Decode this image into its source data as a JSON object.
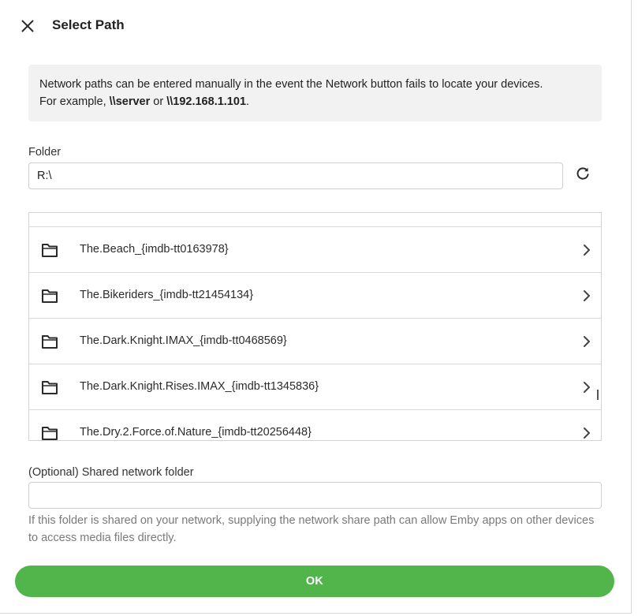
{
  "dialog": {
    "title": "Select Path",
    "close_icon": "close-icon"
  },
  "info": {
    "line1": "Network paths can be entered manually in the event the Network button fails to locate your devices.",
    "line2_prefix": "For example, ",
    "example1": "\\\\server",
    "line2_mid": " or ",
    "example2": "\\\\192.168.1.101",
    "line2_suffix": "."
  },
  "folder": {
    "label": "Folder",
    "value": "R:\\",
    "refresh_icon": "refresh-icon"
  },
  "folders": [
    {
      "name": "The.Beach_{imdb-tt0163978}"
    },
    {
      "name": "The.Bikeriders_{imdb-tt21454134}"
    },
    {
      "name": "The.Dark.Knight.IMAX_{imdb-tt0468569}"
    },
    {
      "name": "The.Dark.Knight.Rises.IMAX_{imdb-tt1345836}"
    },
    {
      "name": "The.Dry.2.Force.of.Nature_{imdb-tt20256448}"
    }
  ],
  "shared": {
    "label": "(Optional) Shared network folder",
    "value": "",
    "help": "If this folder is shared on your network, supplying the network share path can allow Emby apps on other devices to access media files directly."
  },
  "ok_label": "OK",
  "colors": {
    "accent": "#52b54b",
    "info_bg": "#f2f2f2"
  }
}
